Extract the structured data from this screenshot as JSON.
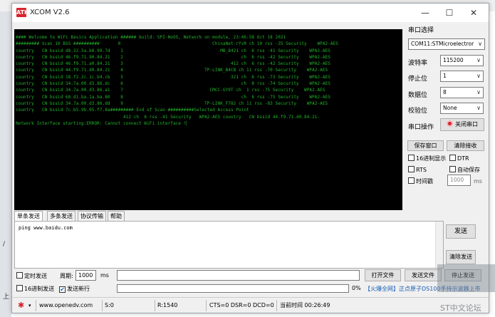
{
  "window": {
    "title": "XCOM V2.6",
    "app_icon": "ATK",
    "controls": {
      "minimize": "—",
      "maximize": "☐",
      "close": "✕"
    }
  },
  "terminal": {
    "lines": [
      "#### Welcome to WiFi Basics Application ###### build: SPI-NoOS, Network on module, 23:46:58 Oct 18 2021",
      "######### Scan 10 BSS ##########       0                                   ChinaNet-rYvR ch 10 rss -35 Security    WPA2-AES",
      "country   CN bssid d8.32.5a.b8.99.7d    1                                     MB_8421 ch  6 rss -41 Security    WPA2-AES",
      "country   CN bssid 46.f9.71.90.84.21    2                                             ch  6 rss -42 Security    WPA2-AES",
      "country   CN bssid 46.f9.71.a0.84.21    3                                         412 ch  6 rss -42 Security    WPA2-AES",
      "country   CN bssid 44.f9.71.d0.84.21    4                               TP-LINK_B4CB ch 11 rss -70 Security    WPA2-AES",
      "country   CN bssid 18.f2.2c.1c.b4.cb    5                                         321 ch  6 rss -73 Security    WPA2-AES",
      "country   CN bssid 34.7a.00.d3.86.dc    6                                             ch  8 rss -74 Security    WPA2-AES",
      "country   CN bssid 34.7a.00.d3.86.a1    7                                 CMCC-GY9T ch  1 rss -75 Security    WPA2-AES",
      "country   CN bssid 68.d1.ba.1a.ba.80    8                                             ch  6 rss -75 Security    WPA2-AES",
      "country   CN bssid 34.7a.00.d3.86.dd    9                               TP-LINK_F782 ch 11 rss -83 Security    WPA2-AES",
      "country   CN bssid 7c.b5.9b.05.f7.8a######### End of Scan ##########Selected Access Point",
      "                                         412 ch  6 rss -41 Security   WPA2-AES country   CN bssid 44.f9.71.d0.84.21-",
      "Network Interface starting:ERROR: Cannot connect WiFi interface !"
    ]
  },
  "side": {
    "port_label": "串口选择",
    "port_value": "COM11:STMicroelectror",
    "baud_label": "波特率",
    "baud_value": "115200",
    "stop_label": "停止位",
    "stop_value": "1",
    "data_label": "数据位",
    "data_value": "8",
    "parity_label": "校验位",
    "parity_value": "None",
    "op_label": "串口操作",
    "close_port": "关闭串口",
    "save_window": "保存窗口",
    "clear_recv": "清除接收",
    "hex_display": "16进制显示",
    "dtr": "DTR",
    "rts": "RTS",
    "auto_save": "自动保存",
    "timestamp": "时间戳",
    "timestamp_ms": "1000",
    "ms": "ms"
  },
  "tabs": [
    "单条发送",
    "多条发送",
    "协议传输",
    "帮助"
  ],
  "send": {
    "text": "ping www.baidu.com",
    "send_btn": "发送",
    "clear_send": "清除发送"
  },
  "bottom": {
    "timed_send": "定时发送",
    "period_label": "周期:",
    "period_value": "1000",
    "ms": "ms",
    "open_file": "打开文件",
    "send_file": "发送文件",
    "stop_send": "停止发送",
    "hex_send": "16进制发送",
    "send_newline": "发送新行",
    "progress": "0%",
    "ad": "【火爆全网】正点原子DS100手持示波器上市"
  },
  "status": {
    "url": "www.openedv.com",
    "s": "S:0",
    "r": "R:1540",
    "signals": "CTS=0 DSR=0 DCD=0",
    "time": "当前时间 00:26:49"
  },
  "desktop": {
    "labels": [
      "/",
      "上"
    ],
    "watermark": "ST中文论坛"
  },
  "colors": {
    "terminal_bg": "#000000",
    "terminal_text": "#21b42d",
    "accent_red": "#d9232d",
    "ad_blue": "#1a5fb4"
  }
}
